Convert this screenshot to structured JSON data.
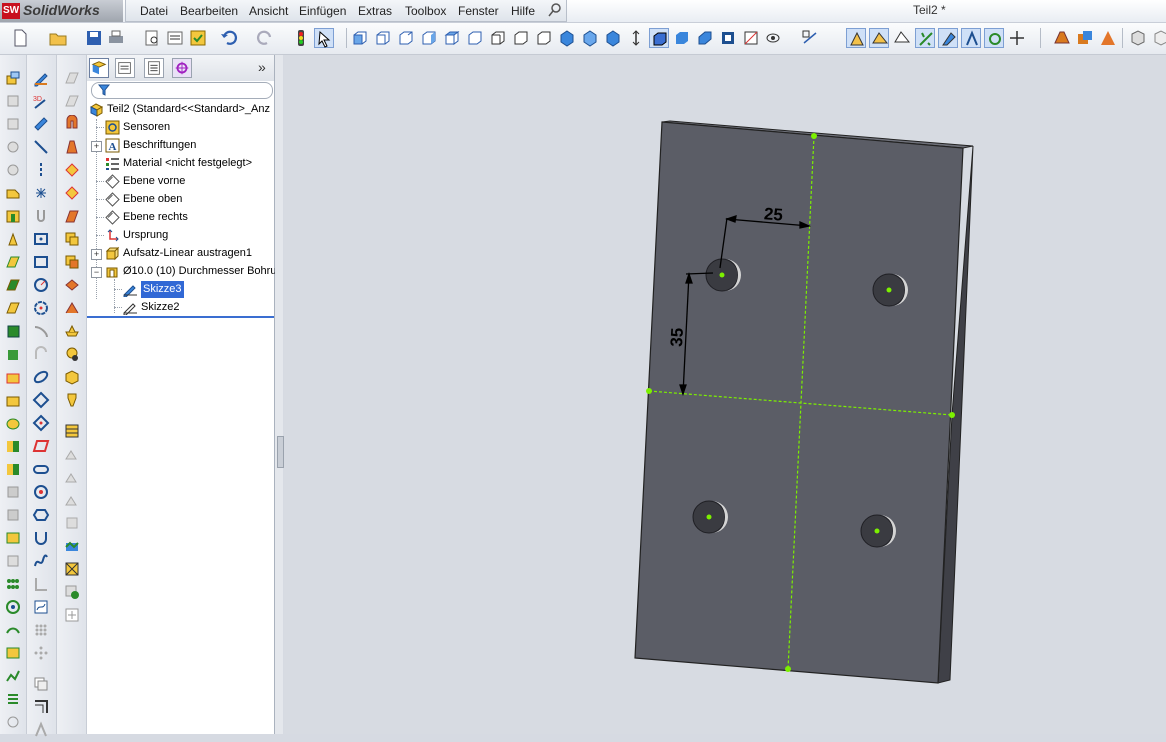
{
  "app": {
    "brand": "SolidWorks",
    "logo_text": "SW",
    "document_title": "Teil2 *"
  },
  "menu": [
    "Datei",
    "Bearbeiten",
    "Ansicht",
    "Einfügen",
    "Extras",
    "Toolbox",
    "Fenster",
    "Hilfe"
  ],
  "feature_tree": {
    "root": "Teil2  (Standard<<Standard>_Anz",
    "items": [
      {
        "label": "Sensoren",
        "icon": "sensor-icon"
      },
      {
        "label": "Beschriftungen",
        "icon": "annotation-icon"
      },
      {
        "label": "Material <nicht festgelegt>",
        "icon": "material-icon"
      },
      {
        "label": "Ebene vorne",
        "icon": "plane-icon"
      },
      {
        "label": "Ebene oben",
        "icon": "plane-icon"
      },
      {
        "label": "Ebene rechts",
        "icon": "plane-icon"
      },
      {
        "label": "Ursprung",
        "icon": "origin-icon"
      },
      {
        "label": "Aufsatz-Linear austragen1",
        "icon": "extrude-icon"
      },
      {
        "label": "Ø10.0 (10) Durchmesser Bohru",
        "icon": "hole-icon"
      }
    ],
    "children": [
      {
        "label": "Skizze3",
        "icon": "sketch-icon",
        "selected": true
      },
      {
        "label": "Skizze2",
        "icon": "sketch-icon",
        "selected": false
      }
    ]
  },
  "dimensions": {
    "horizontal": "25",
    "vertical": "35"
  },
  "colors": {
    "part_face": "#5a5c65",
    "part_edge": "#2b2c31",
    "sketch_line": "#7cf000",
    "selection": "#3168d5"
  }
}
